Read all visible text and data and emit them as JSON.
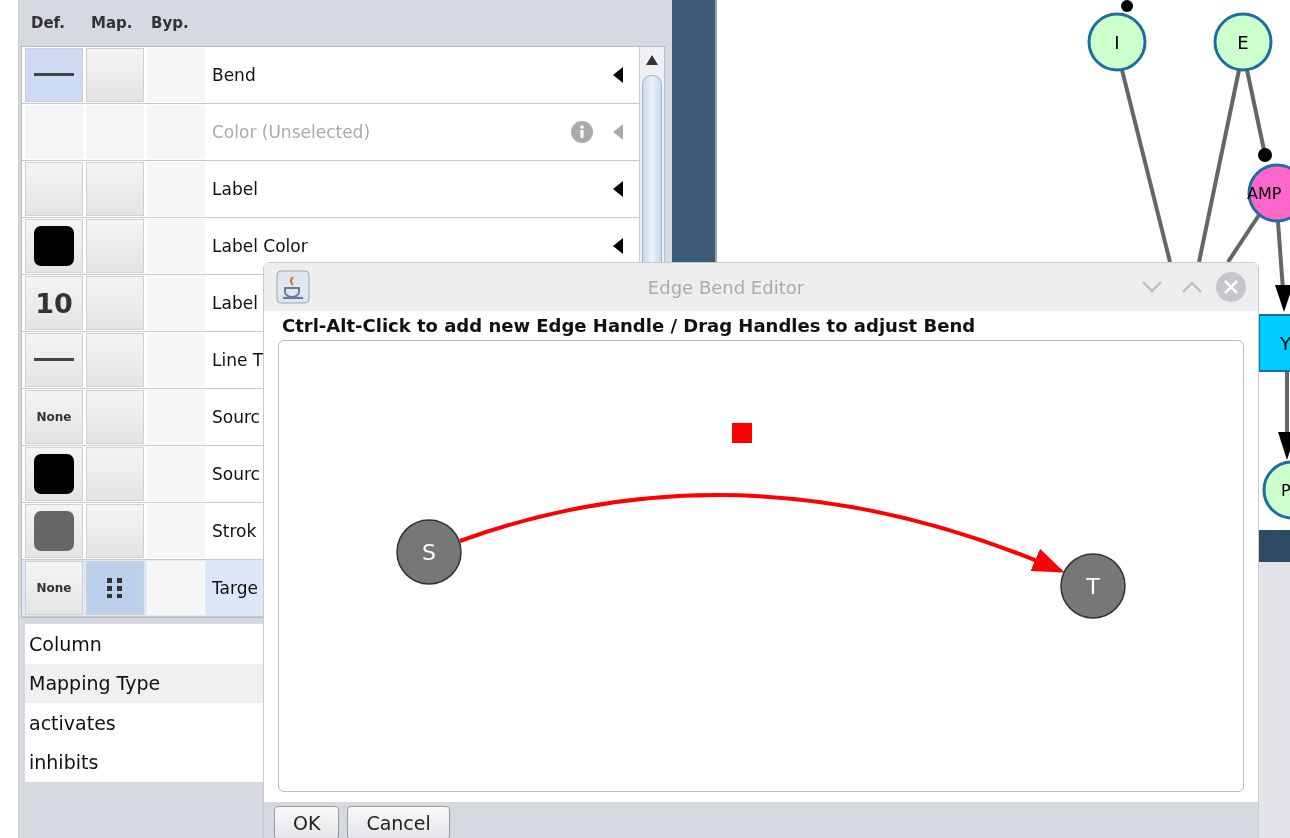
{
  "properties_panel": {
    "columns": [
      "Def.",
      "Map.",
      "Byp."
    ],
    "rows": [
      {
        "label": "Bend",
        "def": {
          "kind": "line"
        },
        "def_focused": true,
        "mapped": false,
        "disabled": false,
        "selected": false
      },
      {
        "label": "Color (Unselected)",
        "def": {
          "kind": "blank"
        },
        "def_focused": false,
        "mapped": false,
        "disabled": true,
        "selected": false
      },
      {
        "label": "Label",
        "def": {
          "kind": "blank"
        },
        "def_focused": false,
        "mapped": false,
        "disabled": false,
        "selected": false
      },
      {
        "label": "Label Color",
        "def": {
          "kind": "swatch",
          "color": "#000000"
        },
        "def_focused": false,
        "mapped": false,
        "disabled": false,
        "selected": false
      },
      {
        "label": "Label",
        "def": {
          "kind": "number",
          "text": "10"
        },
        "def_focused": false,
        "mapped": false,
        "disabled": false,
        "selected": false
      },
      {
        "label": "Line T",
        "def": {
          "kind": "line"
        },
        "def_focused": false,
        "mapped": false,
        "disabled": false,
        "selected": false
      },
      {
        "label": "Sourc",
        "def": {
          "kind": "text",
          "text": "None"
        },
        "def_focused": false,
        "mapped": false,
        "disabled": false,
        "selected": false
      },
      {
        "label": "Sourc",
        "def": {
          "kind": "swatch",
          "color": "#000000"
        },
        "def_focused": false,
        "mapped": false,
        "disabled": false,
        "selected": false
      },
      {
        "label": "Strok",
        "def": {
          "kind": "swatch",
          "color": "#666666"
        },
        "def_focused": false,
        "mapped": false,
        "disabled": false,
        "selected": false
      },
      {
        "label": "Targe",
        "def": {
          "kind": "text",
          "text": "None"
        },
        "def_focused": false,
        "mapped": true,
        "disabled": false,
        "selected": true
      }
    ],
    "mapping": [
      {
        "text": "Column",
        "shaded": false
      },
      {
        "text": "Mapping Type",
        "shaded": true
      },
      {
        "text": "activates",
        "shaded": false
      },
      {
        "text": "inhibits",
        "shaded": false
      }
    ]
  },
  "network": {
    "nodes": [
      {
        "label": "I",
        "kind": "circle",
        "color": "#ccffcc"
      },
      {
        "label": "E",
        "kind": "circle",
        "color": "#ccffcc"
      },
      {
        "label": "AMP",
        "kind": "circle",
        "color": "#ff66cc"
      },
      {
        "label": "Y",
        "kind": "rect",
        "color": "#00ccff"
      },
      {
        "label": "P",
        "kind": "circle",
        "color": "#ccffcc"
      }
    ]
  },
  "dialog": {
    "title": "Edge Bend Editor",
    "instruction": "Ctrl-Alt-Click to add new Edge Handle / Drag Handles to adjust Bend",
    "source": "S",
    "target": "T",
    "buttons": [
      "OK",
      "Cancel"
    ]
  }
}
